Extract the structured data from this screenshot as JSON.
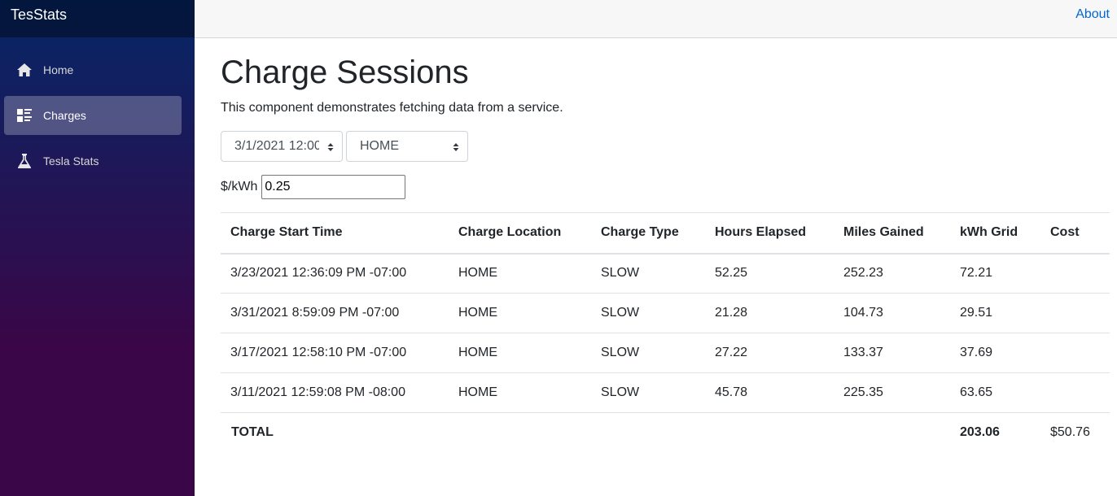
{
  "app": {
    "brand": "TesStats"
  },
  "sidebar": {
    "items": [
      {
        "label": "Home",
        "icon": "home-icon"
      },
      {
        "label": "Charges",
        "icon": "list-icon",
        "active": true
      },
      {
        "label": "Tesla Stats",
        "icon": "beaker-icon"
      }
    ]
  },
  "header": {
    "about": "About"
  },
  "page": {
    "title": "Charge Sessions",
    "description": "This component demonstrates fetching data from a service."
  },
  "filters": {
    "date_value": "3/1/2021 12:00",
    "location_value": "HOME",
    "rate_label": "$/kWh",
    "rate_value": "0.25"
  },
  "table": {
    "headers": [
      "Charge Start Time",
      "Charge Location",
      "Charge Type",
      "Hours Elapsed",
      "Miles Gained",
      "kWh Grid",
      "Cost"
    ],
    "rows": [
      [
        "3/23/2021 12:36:09 PM -07:00",
        "HOME",
        "SLOW",
        "52.25",
        "252.23",
        "72.21",
        ""
      ],
      [
        "3/31/2021 8:59:09 PM -07:00",
        "HOME",
        "SLOW",
        "21.28",
        "104.73",
        "29.51",
        ""
      ],
      [
        "3/17/2021 12:58:10 PM -07:00",
        "HOME",
        "SLOW",
        "27.22",
        "133.37",
        "37.69",
        ""
      ],
      [
        "3/11/2021 12:59:08 PM -08:00",
        "HOME",
        "SLOW",
        "45.78",
        "225.35",
        "63.65",
        ""
      ]
    ],
    "total": {
      "label": "TOTAL",
      "kwh": "203.06",
      "cost": "$50.76"
    }
  },
  "colors": {
    "sidebar_top": "#052767",
    "sidebar_bottom": "#3a0647",
    "link": "#0366d6",
    "text": "#212529"
  }
}
